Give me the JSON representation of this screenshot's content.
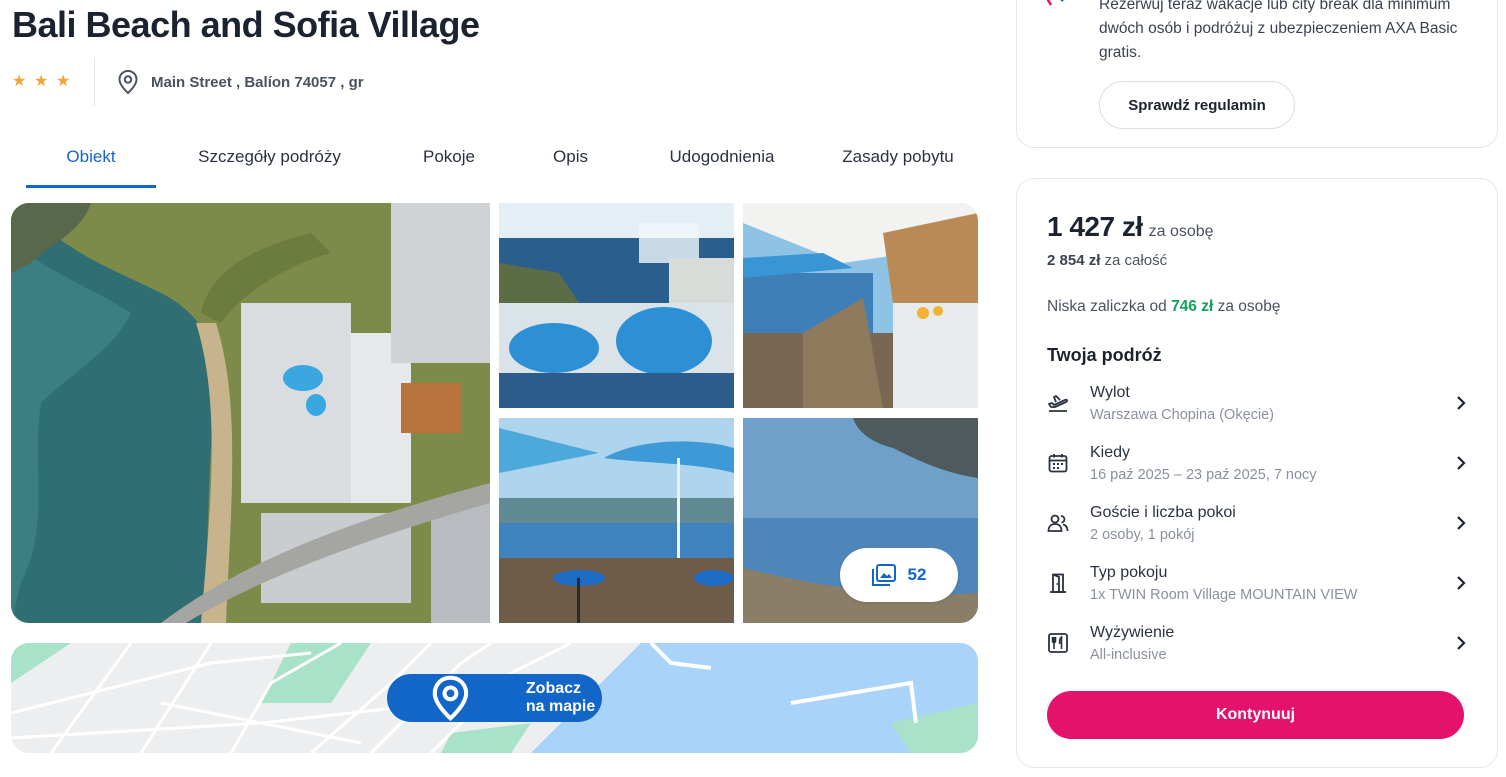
{
  "hotel": {
    "name": "Bali Beach and Sofia Village",
    "stars": 3,
    "address": "Main Street , Balíon 74057 , gr"
  },
  "tabs": [
    {
      "label": "Obiekt",
      "active": true
    },
    {
      "label": "Szczegóły podróży",
      "active": false
    },
    {
      "label": "Pokoje",
      "active": false
    },
    {
      "label": "Opis",
      "active": false
    },
    {
      "label": "Udogodnienia",
      "active": false
    },
    {
      "label": "Zasady pobytu",
      "active": false
    }
  ],
  "gallery": {
    "photo_count": "52",
    "icon": "gallery-icon"
  },
  "map": {
    "button_label": "Zobacz na mapie",
    "icon": "location-pin-icon"
  },
  "promo": {
    "text": "Rezerwuj teraz wakacje lub city break dla minimum dwóch osób i podróżuj z ubezpieczeniem AXA Basic gratis.",
    "button_label": "Sprawdź regulamin"
  },
  "booking": {
    "price": "1 427 zł",
    "price_unit": "za osobę",
    "total_price": "2 854 zł",
    "total_unit": "za całość",
    "deposit_prefix": "Niska zaliczka od",
    "deposit_amount": "746 zł",
    "deposit_suffix": "za osobę",
    "trip_title": "Twoja podróż",
    "items": [
      {
        "label": "Wylot",
        "value": "Warszawa Chopina (Okęcie)",
        "icon": "plane-takeoff-icon"
      },
      {
        "label": "Kiedy",
        "value": "16 paź 2025 – 23 paź 2025, 7 nocy",
        "icon": "calendar-icon"
      },
      {
        "label": "Goście i liczba pokoi",
        "value": "2 osoby, 1 pokój",
        "icon": "guests-icon"
      },
      {
        "label": "Typ pokoju",
        "value": "1x TWIN Room Village MOUNTAIN VIEW",
        "icon": "door-icon"
      },
      {
        "label": "Wyżywienie",
        "value": "All-inclusive",
        "icon": "cutlery-icon"
      }
    ],
    "continue_label": "Kontynuuj"
  },
  "colors": {
    "primary": "#1166c8",
    "accent": "#e2126d",
    "deposit_green": "#12a05c",
    "star": "#f2a33a"
  }
}
